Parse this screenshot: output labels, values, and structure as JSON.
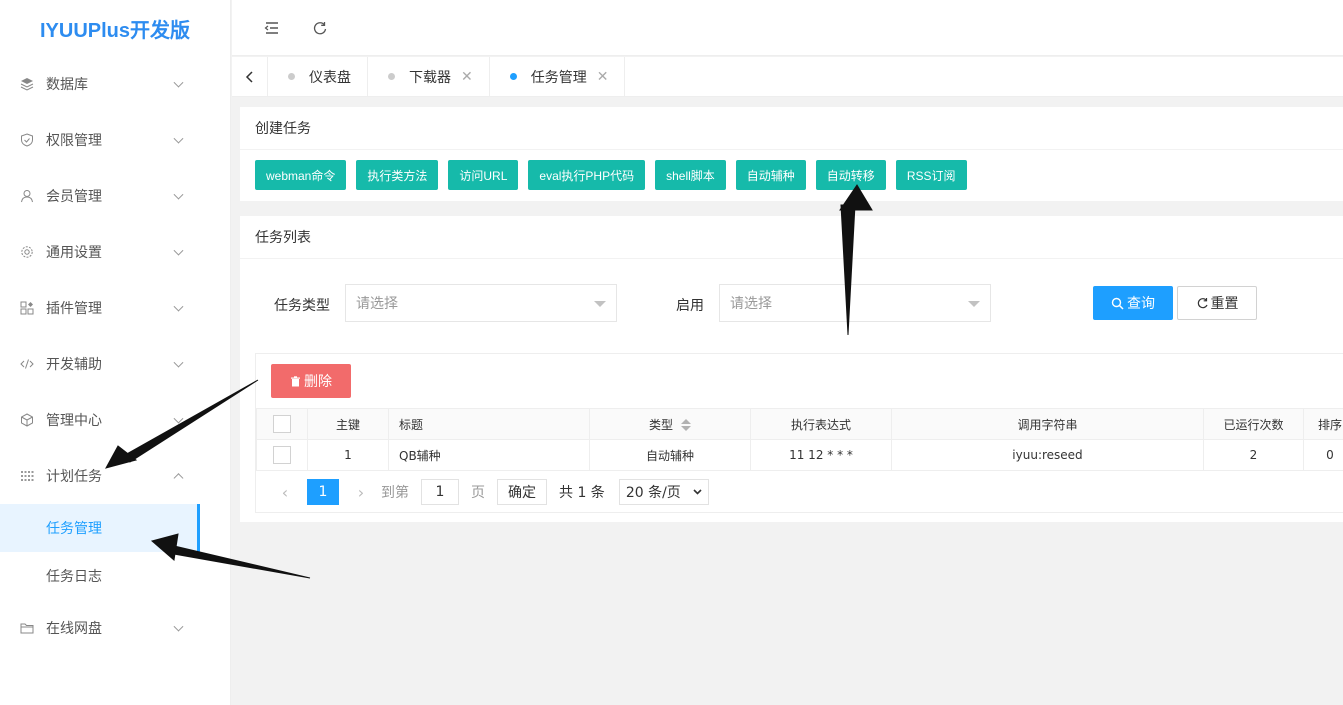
{
  "app": {
    "logo": "IYUUPlus开发版"
  },
  "sidebar": {
    "items": [
      {
        "label": "数据库",
        "icon": "layers-icon",
        "expanded": false
      },
      {
        "label": "权限管理",
        "icon": "shield-icon",
        "expanded": false
      },
      {
        "label": "会员管理",
        "icon": "user-icon",
        "expanded": false
      },
      {
        "label": "通用设置",
        "icon": "gear-icon",
        "expanded": false
      },
      {
        "label": "插件管理",
        "icon": "plugin-icon",
        "expanded": false
      },
      {
        "label": "开发辅助",
        "icon": "code-icon",
        "expanded": false
      },
      {
        "label": "管理中心",
        "icon": "cube-icon",
        "expanded": false
      },
      {
        "label": "计划任务",
        "icon": "calendar-icon",
        "expanded": true
      }
    ],
    "subitems": [
      {
        "label": "任务管理",
        "active": true
      },
      {
        "label": "任务日志",
        "active": false
      }
    ],
    "last_item": {
      "label": "在线网盘",
      "icon": "folder-icon"
    }
  },
  "tabs": [
    {
      "label": "仪表盘",
      "closable": false,
      "active": false
    },
    {
      "label": "下载器",
      "closable": true,
      "active": false
    },
    {
      "label": "任务管理",
      "closable": true,
      "active": true
    }
  ],
  "create_card": {
    "title": "创建任务",
    "buttons": [
      "webman命令",
      "执行类方法",
      "访问URL",
      "eval执行PHP代码",
      "shell脚本",
      "自动辅种",
      "自动转移",
      "RSS订阅"
    ]
  },
  "list_card": {
    "title": "任务列表",
    "filters": {
      "type_label": "任务类型",
      "type_placeholder": "请选择",
      "enable_label": "启用",
      "enable_placeholder": "请选择"
    },
    "query_label": "查询",
    "reset_label": "重置",
    "delete_label": "删除",
    "columns": [
      "主键",
      "标题",
      "类型",
      "执行表达式",
      "调用字符串",
      "已运行次数",
      "排序"
    ],
    "rows": [
      {
        "id": "1",
        "title": "QB辅种",
        "type": "自动辅种",
        "cron": "11 12 * * *",
        "target": "iyuu:reseed",
        "runs": "2",
        "sort": "0"
      }
    ],
    "pager": {
      "current": "1",
      "goto_label": "到第",
      "goto_value": "1",
      "page_label": "页",
      "confirm_label": "确定",
      "total_label": "共 1 条",
      "size_label": "20 条/页"
    }
  },
  "colors": {
    "primary": "#1e9fff",
    "teal": "#16baaa",
    "danger": "#f26b6b",
    "logo": "#2d8cf0"
  }
}
